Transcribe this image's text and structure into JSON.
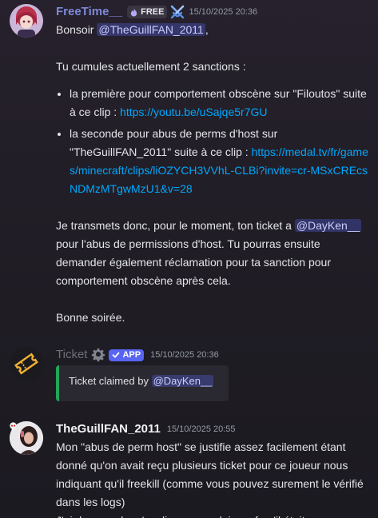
{
  "messages": {
    "m1": {
      "username": "FreeTime__",
      "tag": "FREE",
      "timestamp": "15/10/2025 20:36",
      "greeting_start": "Bonsoir",
      "greeting_mention": "@TheGuillFAN_2011",
      "greeting_end": ",",
      "intro": "Tu cumules actuellement 2 sanctions :",
      "item1_text": "la première pour comportement obscène sur \"Filoutos\" suite à ce clip :",
      "item1_link": "https://youtu.be/uSajqe5r7GU",
      "item2_text": "la seconde pour abus de perms d'host sur \"TheGuillFAN_2011\" suite à ce clip :",
      "item2_link": "https://medal.tv/fr/games/minecraft/clips/liOZYCH3VVhL-CLBi?invite=cr-MSxCREcsNDMzMTgwMzU1&v=28",
      "para_start": "Je transmets donc, pour le moment, ton ticket a",
      "para_mention": "@DayKen__",
      "para_end": "pour l'abus de permissions d'host. Tu pourras ensuite demander également réclamation pour ta sanction pour comportement obscène après cela.",
      "signoff": "Bonne soirée."
    },
    "m2": {
      "username": "Ticket",
      "tag": "APP",
      "timestamp": "15/10/2025 20:36",
      "embed_text": "Ticket claimed by",
      "embed_mention": "@DayKen__"
    },
    "m3": {
      "username": "TheGuillFAN_2011",
      "timestamp": "15/10/2025 20:55",
      "text": "Mon \"abus de perm host\" se justifie assez facilement étant donné qu'on avait reçu plusieurs ticket pour ce joueur nous indiquant qu'il freekill (comme vous pouvez surement le vérifié dans les logs)",
      "text2": "J'ai donc voulu m'expliquer avec lui, sauf qu'il était"
    }
  },
  "colors": {
    "freetime_name": "#7f88d9",
    "ticket_name": "#6d6f78",
    "guill_name": "#f2f3f5",
    "embed_border": "#23a55a",
    "app_badge": "#5865f2"
  },
  "icons": [
    "flame-icon",
    "crossed-swords-icon",
    "gear-icon",
    "check-icon",
    "ticket-icon",
    "skull-badge-icon"
  ]
}
